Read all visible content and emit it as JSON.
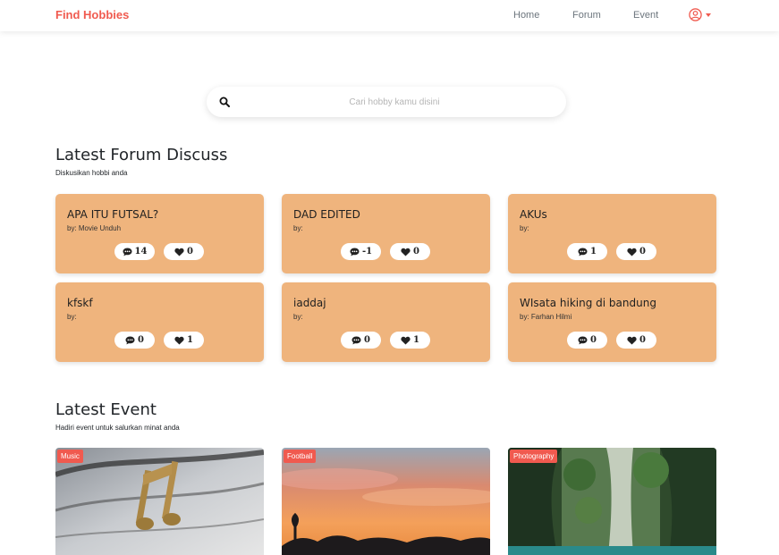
{
  "navbar": {
    "brand": "Find Hobbies",
    "links": [
      "Home",
      "Forum",
      "Event"
    ],
    "colors": {
      "brand": "#f05a4f",
      "link": "#6c757d"
    }
  },
  "search": {
    "placeholder": "Cari hobby kamu disini",
    "value": ""
  },
  "forum_section": {
    "title": "Latest Forum Discuss",
    "subtitle": "Diskusikan hobbi anda",
    "card_color": "#efb47d",
    "posts": [
      {
        "title": "APA ITU FUTSAL?",
        "author": "by: Movie Unduh",
        "comments": "14",
        "likes": "0"
      },
      {
        "title": "DAD EDITED",
        "author": "by:",
        "comments": "-1",
        "likes": "0"
      },
      {
        "title": "AKUs",
        "author": "by:",
        "comments": "1",
        "likes": "0"
      },
      {
        "title": "kfskf",
        "author": "by:",
        "comments": "0",
        "likes": "1"
      },
      {
        "title": "iaddaj",
        "author": "by:",
        "comments": "0",
        "likes": "1"
      },
      {
        "title": "WIsata hiking di bandung",
        "author": "by: Farhan Hilmi",
        "comments": "0",
        "likes": "0"
      }
    ]
  },
  "event_section": {
    "title": "Latest Event",
    "subtitle": "Hadiri event untuk salurkan minat anda",
    "badge_color": "#f05a4f",
    "events": [
      {
        "category": "Music",
        "image": "music-notes-photo"
      },
      {
        "category": "Football",
        "image": "sunset-photo"
      },
      {
        "category": "Photography",
        "image": "waterfall-cave-photo"
      }
    ]
  }
}
